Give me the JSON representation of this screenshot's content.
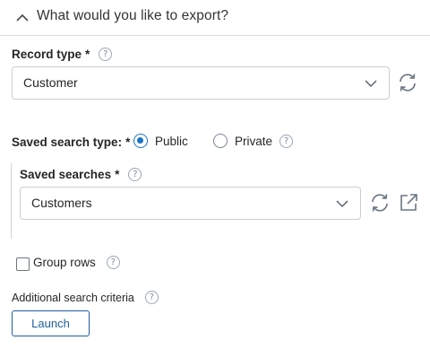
{
  "section": {
    "title": "What would you like to export?"
  },
  "record_type": {
    "label": "Record type",
    "required_mark": "*",
    "value": "Customer"
  },
  "saved_search_type": {
    "label": "Saved search type:",
    "required_mark": "*",
    "options": [
      {
        "label": "Public",
        "selected": true
      },
      {
        "label": "Private",
        "selected": false
      }
    ]
  },
  "saved_searches": {
    "label": "Saved searches",
    "required_mark": "*",
    "value": "Customers"
  },
  "group_rows": {
    "label": "Group rows",
    "checked": false
  },
  "additional_criteria": {
    "label": "Additional search criteria"
  },
  "launch": {
    "label": "Launch"
  },
  "help_glyph": "?",
  "colors": {
    "accent": "#1a73c8",
    "button_border": "#1f5f9e",
    "divider": "#dcdcdc"
  }
}
